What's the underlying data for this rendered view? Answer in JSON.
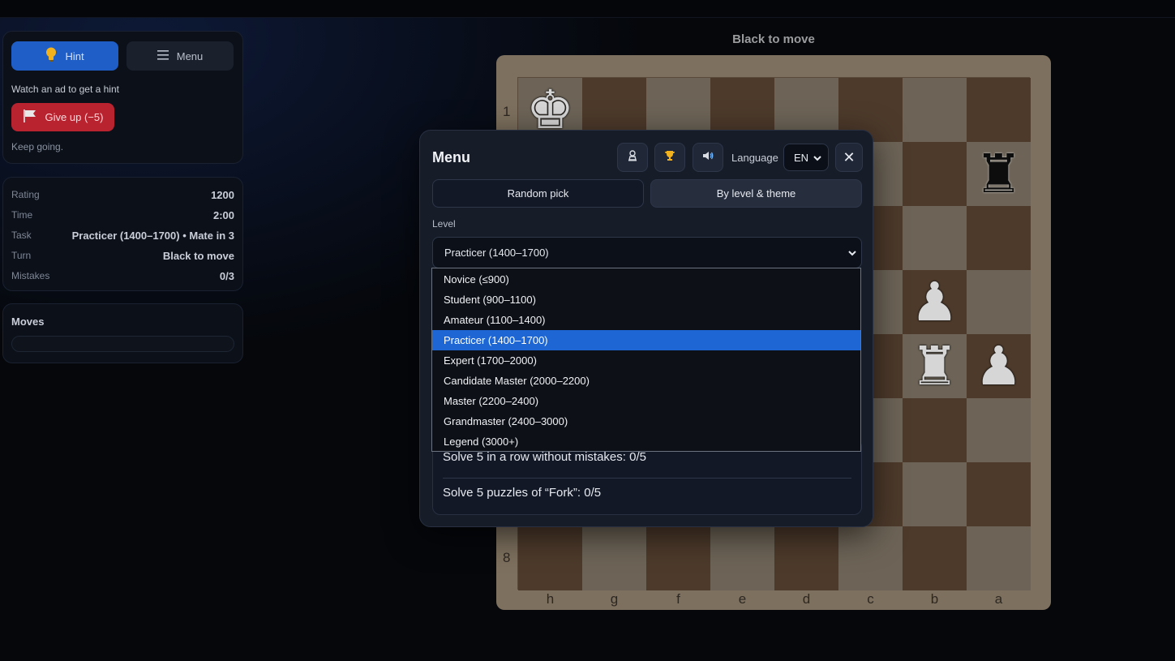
{
  "sidebar": {
    "hint_label": "Hint",
    "menu_label": "Menu",
    "hint_note": "Watch an ad to get a hint",
    "giveup_label": "Give up (−5)",
    "status_note": "Keep going.",
    "stats": [
      {
        "label": "Rating",
        "value": "1200"
      },
      {
        "label": "Time",
        "value": "2:00"
      },
      {
        "label": "Task",
        "value": "Practicer (1400–1700) • Mate in 3"
      },
      {
        "label": "Turn",
        "value": "Black to move"
      },
      {
        "label": "Mistakes",
        "value": "0/3"
      }
    ],
    "moves_title": "Moves"
  },
  "board": {
    "turn_label": "Black to move",
    "ranks_visible": [
      "1",
      "8"
    ],
    "files": [
      "h",
      "g",
      "f",
      "e",
      "d",
      "c",
      "b",
      "a"
    ]
  },
  "menu": {
    "title": "Menu",
    "language_label": "Language",
    "language_value": "EN",
    "close_symbol": "✕",
    "mode_random": "Random pick",
    "mode_level": "By level & theme",
    "level_label": "Level",
    "level_selected": "Practicer (1400–1700)",
    "level_options": [
      "Novice (≤900)",
      "Student (900–1100)",
      "Amateur (1100–1400)",
      "Practicer (1400–1700)",
      "Expert (1700–2000)",
      "Candidate Master (2000–2200)",
      "Master (2200–2400)",
      "Grandmaster (2400–3000)",
      "Legend (3000+)"
    ],
    "goals": [
      "Solve 5 in a row without mistakes: 0/5",
      "Solve 5 puzzles of “Fork”: 0/5"
    ]
  },
  "colors": {
    "accent": "#1f5ec7",
    "danger": "#b8232f",
    "selected_option": "#1d66d3"
  },
  "icons": {
    "hint": "lightbulb-icon",
    "menu": "hamburger-icon",
    "giveup": "flag-icon",
    "profile": "pawn-icon",
    "trophy": "trophy-icon",
    "sound": "speaker-icon",
    "close": "close-icon"
  }
}
